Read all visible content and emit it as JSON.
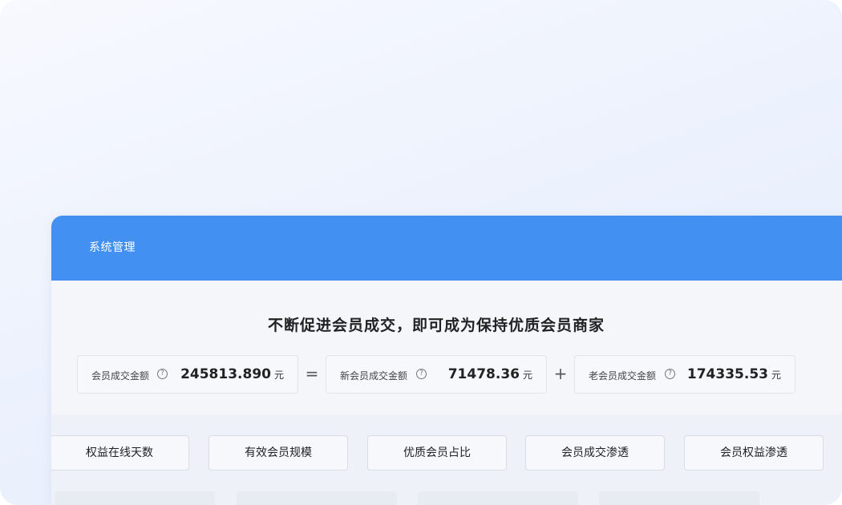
{
  "header": {
    "title": "系统管理"
  },
  "headline": "不断促进会员成交，即可成为保持优质会员商家",
  "metrics": [
    {
      "label": "会员成交金额",
      "value": "245813.890",
      "unit": "元"
    },
    {
      "label": "新会员成交金额",
      "value": "71478.36",
      "unit": "元"
    },
    {
      "label": "老会员成交金额",
      "value": "174335.53",
      "unit": "元"
    }
  ],
  "operators": {
    "equals": "=",
    "plus": "+"
  },
  "help_glyph": "?",
  "tabs": [
    {
      "label": "权益在线天数"
    },
    {
      "label": "有效会员规模"
    },
    {
      "label": "优质会员占比"
    },
    {
      "label": "会员成交渗透"
    },
    {
      "label": "会员权益渗透"
    }
  ],
  "colors": {
    "header": "#4291f2",
    "background": "#eef3fd"
  }
}
